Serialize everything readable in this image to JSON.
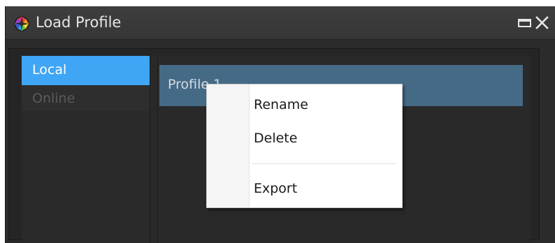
{
  "window": {
    "title": "Load Profile",
    "app_icon": "colorful-aperture-icon",
    "maximize_icon": "maximize-icon",
    "close_icon": "close-icon",
    "maximize_glyph": "▭",
    "close_glyph": "✕"
  },
  "sidebar": {
    "tabs": [
      {
        "label": "Local",
        "selected": true
      },
      {
        "label": "Online",
        "selected": false,
        "disabled": true
      }
    ]
  },
  "profiles": {
    "items": [
      {
        "label": "Profile 1",
        "selected": true
      }
    ]
  },
  "context_menu": {
    "items": [
      {
        "label": "Rename"
      },
      {
        "label": "Delete"
      },
      {
        "label": "Export"
      }
    ]
  },
  "colors": {
    "selected_tab": "#3ea6f5",
    "selected_row": "#456a86",
    "window_bg": "#2b2b2b",
    "titlebar": "#3a3a3a"
  }
}
